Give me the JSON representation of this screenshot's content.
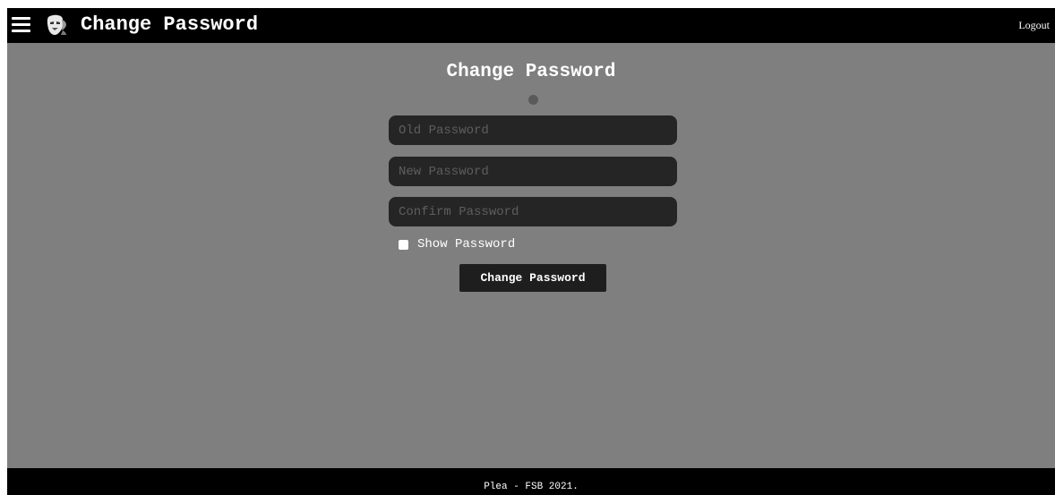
{
  "header": {
    "menu_icon": "hamburger-menu-icon",
    "logo_icon": "masked-face-logo-icon",
    "title": "Change Password",
    "logout_label": "Logout"
  },
  "form": {
    "heading": "Change Password",
    "old_password_placeholder": "Old Password",
    "new_password_placeholder": "New Password",
    "confirm_password_placeholder": "Confirm Password",
    "show_password_label": "Show Password",
    "show_password_checked": false,
    "submit_label": "Change Password"
  },
  "footer": {
    "text": "Plea - FSB 2021."
  },
  "colors": {
    "background": "#7f7f7f",
    "bar": "#000000",
    "field": "#252525",
    "button": "#1e1e1e",
    "status_dot": "#5a5a5a"
  }
}
